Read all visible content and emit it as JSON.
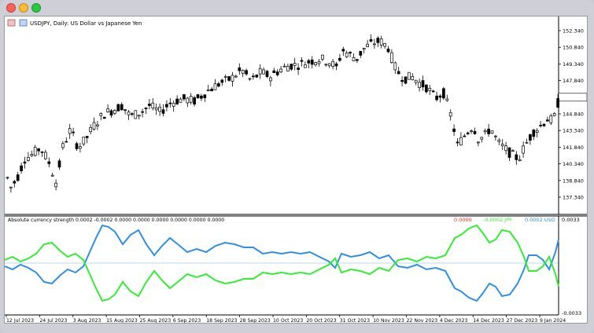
{
  "window": {
    "controls": [
      "close",
      "minimize",
      "zoom"
    ]
  },
  "main_chart": {
    "symbol_title": "USDJPY, Daily:  US Dollar vs Japanese Yen",
    "price_axis": {
      "ticks": [
        "152.340",
        "150.840",
        "149.340",
        "147.840",
        "146.340",
        "144.840",
        "143.340",
        "141.840",
        "140.340",
        "138.840",
        "137.340"
      ],
      "current_price": "146.340"
    },
    "time_axis": {
      "ticks": [
        "12 Jul 2023",
        "24 Jul 2023",
        "3 Aug 2023",
        "15 Aug 2023",
        "25 Aug 2023",
        "6 Sep 2023",
        "18 Sep 2023",
        "28 Sep 2023",
        "10 Oct 2023",
        "20 Oct 2023",
        "31 Oct 2023",
        "10 Nov 2023",
        "22 Nov 2023",
        "4 Dec 2023",
        "14 Dec 2023",
        "27 Dec 2023",
        "9 Jan 2024"
      ]
    }
  },
  "indicator": {
    "title": "Absolute currency strength 0.0002 -0.0002 0.0000 0.0000 0.0000 0.0000 0.0000 0.0000",
    "values": {
      "zero": "0.0000",
      "jpy": "-0.0002 JPY",
      "usd": "0.0002 USD"
    },
    "axis": {
      "top": "0.0033",
      "bottom": "-0.0033"
    },
    "colors": {
      "jpy": "#33ee33",
      "usd": "#2f8fe8",
      "zero_value_text": "#ff2222"
    }
  },
  "chart_data": {
    "type": "line",
    "title": "Absolute currency strength",
    "series": [
      {
        "name": "JPY"
      },
      {
        "name": "USD"
      }
    ]
  }
}
